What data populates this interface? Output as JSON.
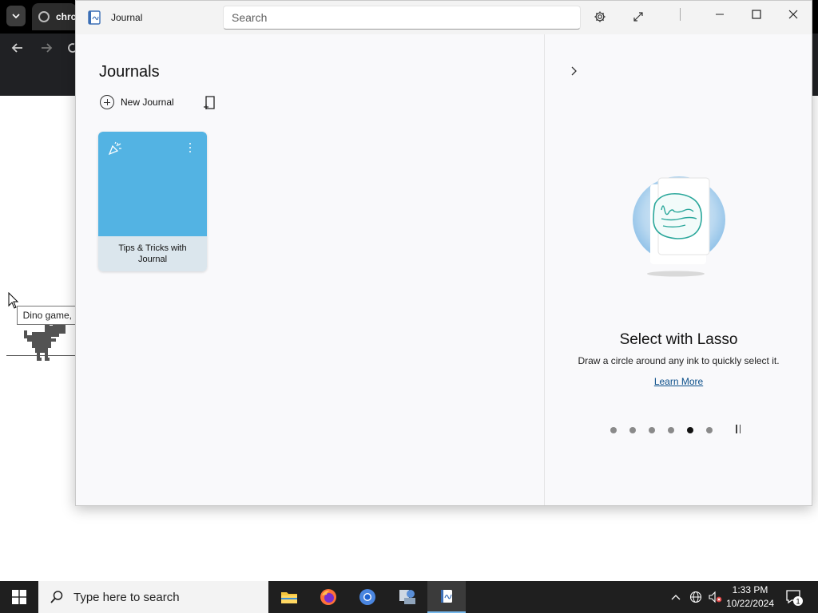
{
  "browser": {
    "tab_title": "chrc",
    "tooltip": "Dino game, play"
  },
  "journal": {
    "app_title": "Journal",
    "search_placeholder": "Search",
    "heading": "Journals",
    "new_journal_label": "New Journal",
    "journals": [
      {
        "title": "Tips & Tricks with Journal",
        "cover_color": "#53b3e3"
      }
    ],
    "side_panel": {
      "tip_title": "Select with Lasso",
      "tip_description": "Draw a circle around any ink to quickly select it.",
      "learn_more": "Learn More",
      "carousel_total": 6,
      "carousel_active_index": 4
    }
  },
  "taskbar": {
    "search_placeholder": "Type here to search",
    "time": "1:33 PM",
    "date": "10/22/2024",
    "notification_count": "1",
    "pinned_apps": [
      "file-explorer",
      "firefox",
      "chromium",
      "journal-alt",
      "journal"
    ]
  }
}
